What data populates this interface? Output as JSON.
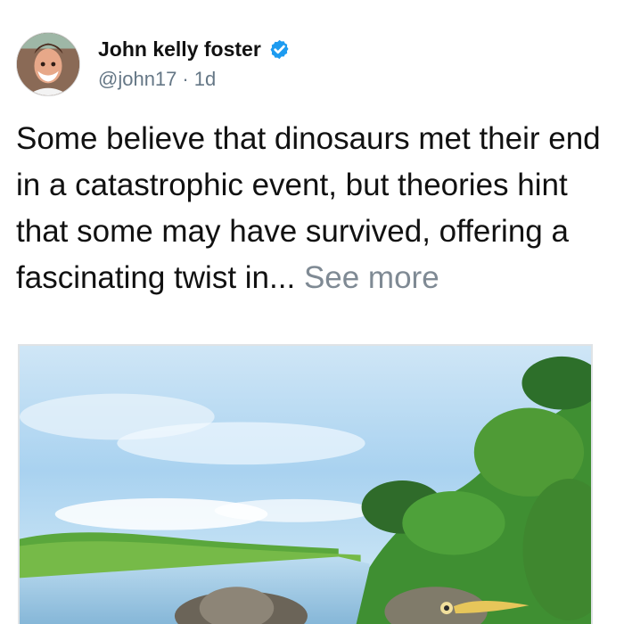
{
  "author": {
    "name": "John kelly foster",
    "handle": "@john17",
    "separator": "·",
    "age": "1d",
    "verified": true,
    "avatar_icon": "user-avatar-photo"
  },
  "post": {
    "text": "Some believe that dinosaurs met their end in a catastrophic event, but theories hint that some may have survived, offering a fascinating twist in...",
    "see_more_label": "See more"
  },
  "media": {
    "kind": "nature-photo",
    "scene": "river-with-herons"
  },
  "colors": {
    "verified_blue": "#1d9bf0",
    "text_primary": "#111111",
    "text_secondary": "#657786",
    "see_more": "#7f8a94"
  }
}
